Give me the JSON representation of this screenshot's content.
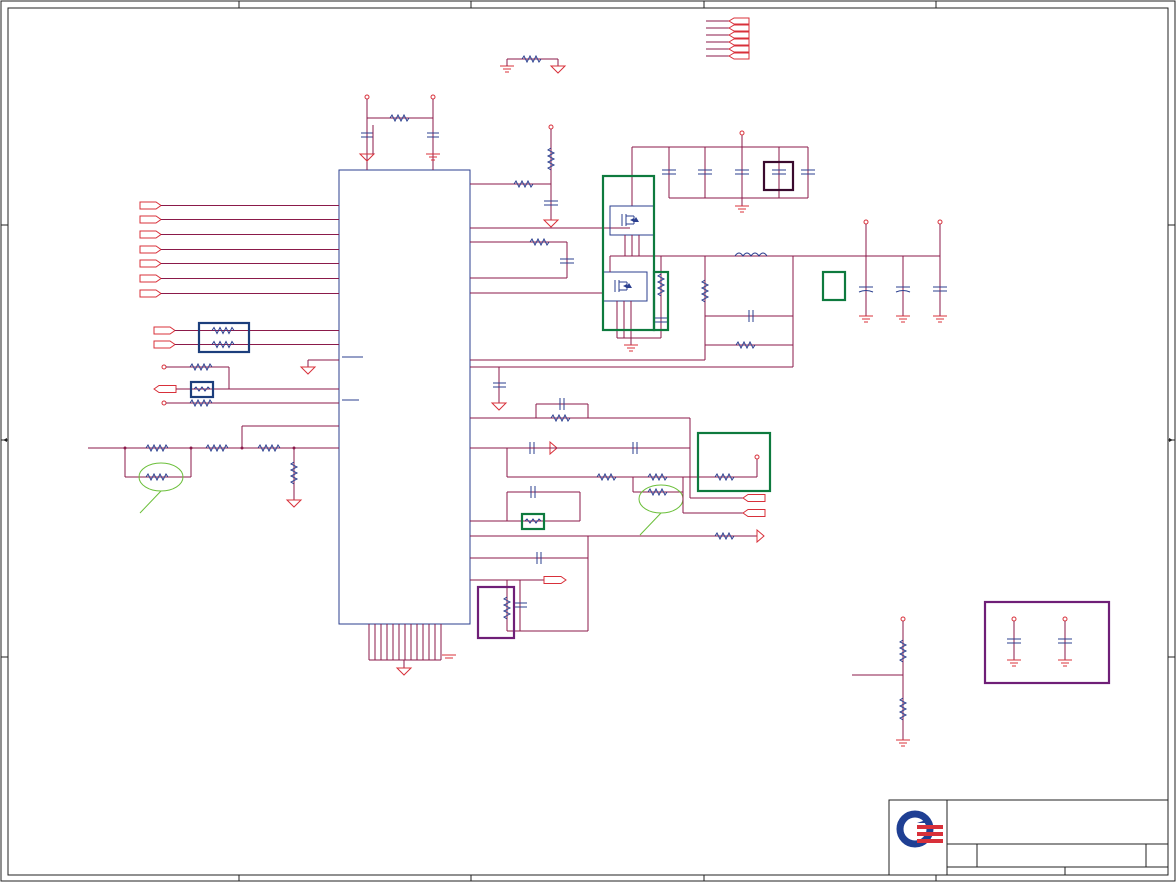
{
  "sheet": {
    "title_block": {
      "logo_colors": {
        "primary": "#1f3f93",
        "accent": "#d8303a"
      },
      "title": "",
      "doc_number": "",
      "revision": ""
    }
  },
  "colors": {
    "wire": "#8b1a4a",
    "net_label": "#d8303a",
    "component": "#2b3f8f",
    "highlight_green": "#0e7a3e",
    "highlight_purple": "#6f1f77",
    "highlight_navy": "#1c3e7c",
    "annotation_callout": "#6bbf3a"
  }
}
